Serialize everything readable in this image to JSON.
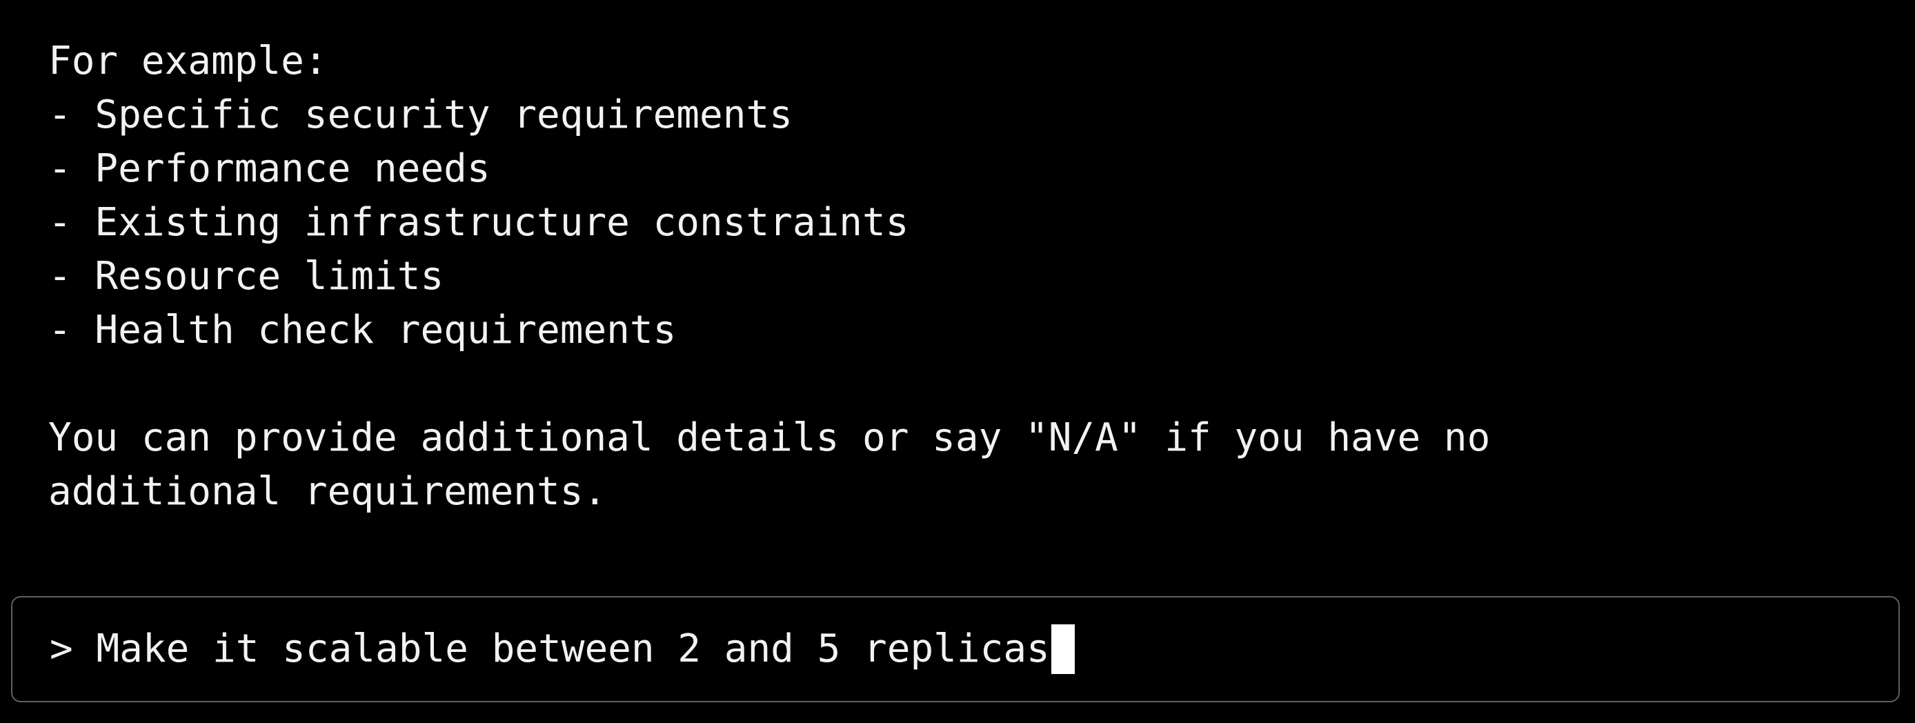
{
  "output": {
    "lines": [
      "For example:",
      "- Specific security requirements",
      "- Performance needs",
      "- Existing infrastructure constraints",
      "- Resource limits",
      "- Health check requirements",
      "",
      "You can provide additional details or say \"N/A\" if you have no",
      "additional requirements."
    ]
  },
  "input": {
    "prompt_symbol": ">",
    "value": "Make it scalable between 2 and 5 replicas"
  },
  "colors": {
    "background": "#000000",
    "text": "#f2f2f2",
    "border": "#5f5f5f",
    "cursor": "#ffffff"
  }
}
